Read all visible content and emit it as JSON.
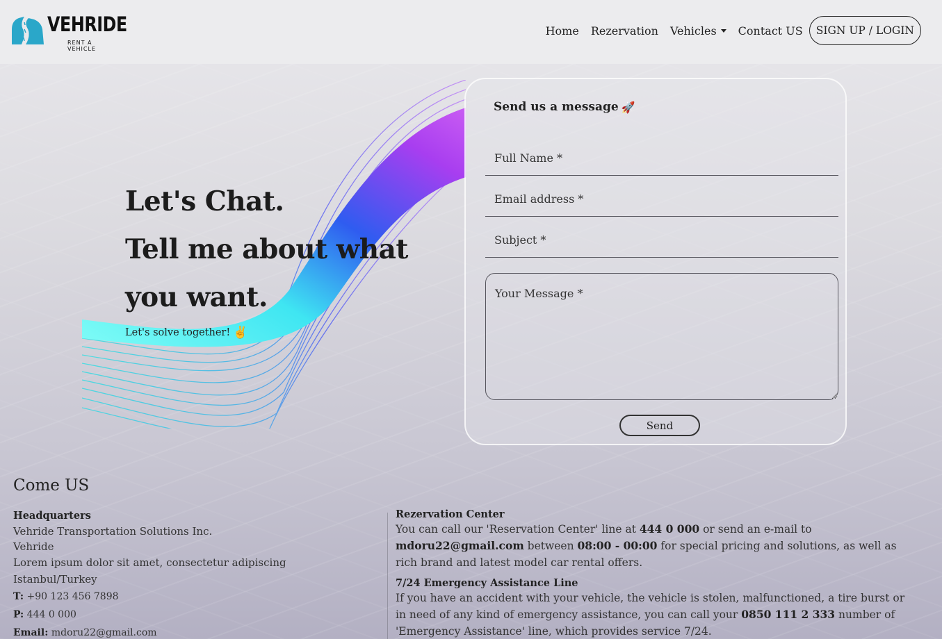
{
  "brand": {
    "name": "VEHRIDE",
    "tagline": "RENT A VEHICLE"
  },
  "nav": {
    "items": [
      "Home",
      "Rezervation",
      "Vehicles",
      "Contact US"
    ],
    "login_label": "SIGN UP / LOGIN"
  },
  "hero": {
    "line1": "Let's Chat.",
    "line2": "Tell me about what",
    "line3": "you want.",
    "subtitle": "Let's solve together!"
  },
  "form": {
    "title": "Send us a message",
    "name_placeholder": "Full Name *",
    "email_placeholder": "Email address *",
    "subject_placeholder": "Subject *",
    "message_placeholder": "Your Message *",
    "send_label": "Send"
  },
  "contact": {
    "title": "Come US",
    "headquarters": {
      "heading": "Headquarters",
      "company": "Vehride Transportation Solutions Inc.",
      "name": "Vehride",
      "address1": "Lorem ipsum dolor sit amet, consectetur adipiscing",
      "address2": "Istanbul/Turkey",
      "t_label": "T:",
      "t_value": "+90 123 456 7898",
      "p_label": "P:",
      "p_value": "444 0 000",
      "email_label": "Email:",
      "email_value": "mdoru22@gmail.com"
    },
    "reservation": {
      "heading": "Rezervation Center",
      "text1": "You can call our 'Reservation Center' line at",
      "phone": "444 0 000",
      "text2": "or send an e-mail to",
      "email": "mdoru22@gmail.com",
      "text3": "between",
      "hours": "08:00 - 00:00",
      "text4": "for special pricing and solutions, as well as rich brand and latest model car rental offers."
    },
    "emergency": {
      "heading": "7/24 Emergency Assistance Line",
      "text1": "If you have an accident with your vehicle, the vehicle is stolen, malfunctioned, a tire burst or in need of any kind of emergency assistance, you can call your",
      "phone": "0850 111 2 333",
      "text2": "number of 'Emergency Assistance' line, which provides service 7/24."
    }
  },
  "colors": {
    "logo_teal": "#2aa7c9",
    "ribbon_cyan": "#5ff2f0",
    "ribbon_blue": "#2f5cf0",
    "ribbon_purple": "#b03df0"
  },
  "icons": [
    "road-logo-icon",
    "rocket-icon",
    "hand-icon",
    "chevron-down-icon"
  ]
}
